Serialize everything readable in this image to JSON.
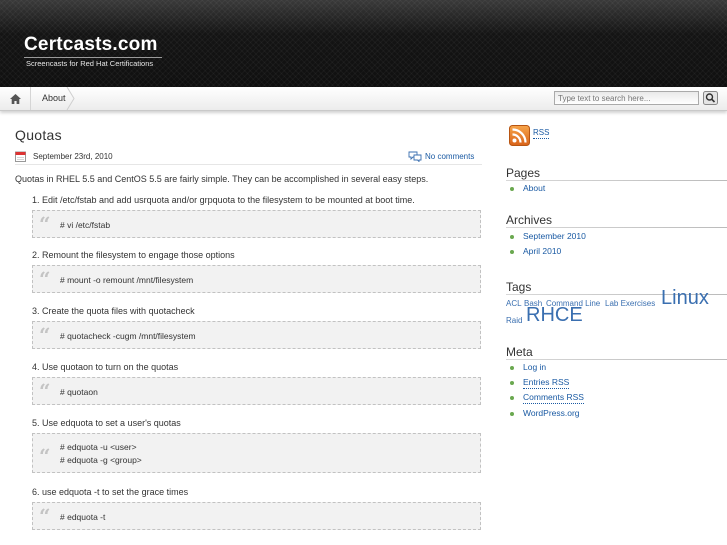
{
  "header": {
    "site_title": "Certcasts.com",
    "site_description": "Screencasts for Red Hat Certifications"
  },
  "nav": {
    "home_icon": "home-icon",
    "items": [
      {
        "label": "About"
      }
    ],
    "search_placeholder": "Type text to search here...",
    "search_icon": "magnifier-icon"
  },
  "post": {
    "title": "Quotas",
    "date": "September 23rd, 2010",
    "comments_label": "No comments",
    "intro": "Quotas in RHEL 5.5 and CentOS 5.5 are fairly simple.  They can be accomplished in several easy steps.",
    "steps": [
      {
        "label": "1. Edit /etc/fstab and add usrquota and/or grpquota to the filesystem to be mounted at boot time.",
        "code": [
          "# vi /etc/fstab"
        ]
      },
      {
        "label": "2. Remount the filesystem to engage those options",
        "code": [
          "# mount -o remount /mnt/filesystem"
        ]
      },
      {
        "label": "3. Create the quota files with quotacheck",
        "code": [
          "# quotacheck -cugm /mnt/filesystem"
        ]
      },
      {
        "label": "4. Use quotaon to turn on the quotas",
        "code": [
          "# quotaon"
        ]
      },
      {
        "label": "5. Use edquota to set a user's quotas",
        "code": [
          "# edquota -u <user>",
          "# edquota -g <group>"
        ]
      },
      {
        "label": "6. use edquota -t to set the grace times",
        "code": [
          "# edquota -t"
        ]
      }
    ]
  },
  "sidebar": {
    "rss_label": "RSS",
    "pages": {
      "title": "Pages",
      "items": [
        "About"
      ]
    },
    "archives": {
      "title": "Archives",
      "items": [
        "September 2010",
        "April 2010"
      ]
    },
    "tags": {
      "title": "Tags",
      "items": [
        {
          "label": "ACL"
        },
        {
          "label": "Bash"
        },
        {
          "label": "Command Line"
        },
        {
          "label": "Lab Exercises"
        },
        {
          "label": "Linux"
        },
        {
          "label": "Raid"
        },
        {
          "label": "RHCE"
        }
      ]
    },
    "meta": {
      "title": "Meta",
      "items": [
        "Log in",
        "Entries RSS",
        "Comments RSS",
        "WordPress.org"
      ]
    }
  },
  "colors": {
    "link": "#1a5aa3",
    "bullet": "#6aa84f",
    "header_bg": "#1c1c1c"
  }
}
